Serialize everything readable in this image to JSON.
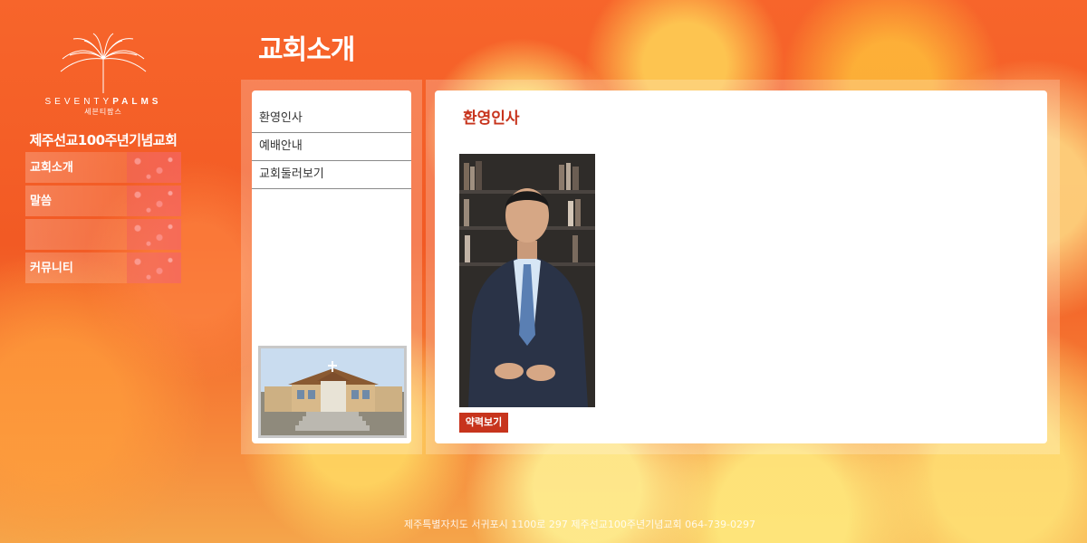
{
  "brand": {
    "name_en_light": "SEVENTY",
    "name_en_bold": "PALMS",
    "name_ko": "세븐티팜스"
  },
  "church_name": "제주선교100주년기념교회",
  "side_nav": {
    "items": [
      {
        "label": "교회소개"
      },
      {
        "label": "말씀"
      },
      {
        "label": ""
      },
      {
        "label": "커뮤니티"
      }
    ]
  },
  "page_title": "교회소개",
  "submenu": {
    "items": [
      {
        "label": "환영인사"
      },
      {
        "label": "예배안내"
      },
      {
        "label": "교회둘러보기"
      }
    ]
  },
  "content": {
    "title": "환영인사",
    "profile_button_label": "약력보기"
  },
  "footer": {
    "text": "제주특별자치도 서귀포시 1100로 297  제주선교100주년기념교회  064-739-0297"
  },
  "colors": {
    "accent": "#c7341d",
    "background": "#f25a24"
  }
}
